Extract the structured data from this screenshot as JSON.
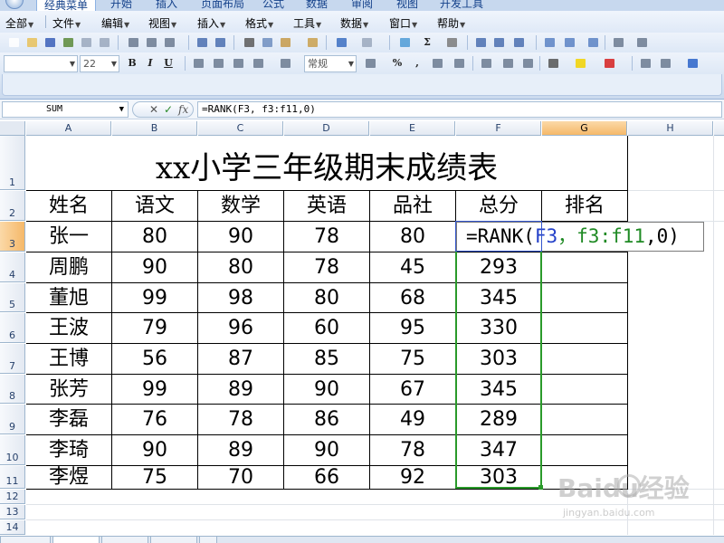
{
  "ribbon": {
    "tabs": [
      "经典菜单",
      "开始",
      "插入",
      "页面布局",
      "公式",
      "数据",
      "审阅",
      "视图",
      "开发工具"
    ]
  },
  "menubar": {
    "items": [
      "全部",
      "文件",
      "编辑",
      "视图",
      "插入",
      "格式",
      "工具",
      "数据",
      "窗口",
      "帮助"
    ]
  },
  "toolbar": {
    "font_size": "22",
    "number_format": "常规",
    "bold": "B",
    "italic": "I",
    "underline": "U",
    "percent": "%",
    "comma": ",",
    "sigma": "Σ"
  },
  "formula_bar": {
    "name_box": "SUM",
    "cancel": "✕",
    "enter": "✓",
    "fx": "fx",
    "formula": "=RANK(F3, f3:f11,0)"
  },
  "columns": [
    "A",
    "B",
    "C",
    "D",
    "E",
    "F",
    "G",
    "H"
  ],
  "rows": [
    "1",
    "2",
    "3",
    "4",
    "5",
    "6",
    "7",
    "8",
    "9",
    "10",
    "11",
    "12",
    "13",
    "14"
  ],
  "sheet": {
    "title": "xx小学三年级期末成绩表",
    "headers": [
      "姓名",
      "语文",
      "数学",
      "英语",
      "品社",
      "总分",
      "排名"
    ],
    "data": [
      [
        "张一",
        "80",
        "90",
        "78",
        "80",
        ""
      ],
      [
        "周鹏",
        "90",
        "80",
        "78",
        "45",
        "293"
      ],
      [
        "董旭",
        "99",
        "98",
        "80",
        "68",
        "345"
      ],
      [
        "王波",
        "79",
        "96",
        "60",
        "95",
        "330"
      ],
      [
        "王博",
        "56",
        "87",
        "85",
        "75",
        "303"
      ],
      [
        "张芳",
        "99",
        "89",
        "90",
        "67",
        "345"
      ],
      [
        "李磊",
        "76",
        "78",
        "86",
        "49",
        "289"
      ],
      [
        "李琦",
        "90",
        "89",
        "90",
        "78",
        "347"
      ],
      [
        "李煜",
        "75",
        "70",
        "66",
        "92",
        "303"
      ]
    ],
    "edit_cell": {
      "prefix": "=RANK(",
      "ref1": "F3",
      "sep": "，",
      "ref2": "f3:f11",
      "suffix": ",0)"
    }
  },
  "watermark": {
    "text": "Baidu经验",
    "sub": "jingyan.baidu.com"
  }
}
